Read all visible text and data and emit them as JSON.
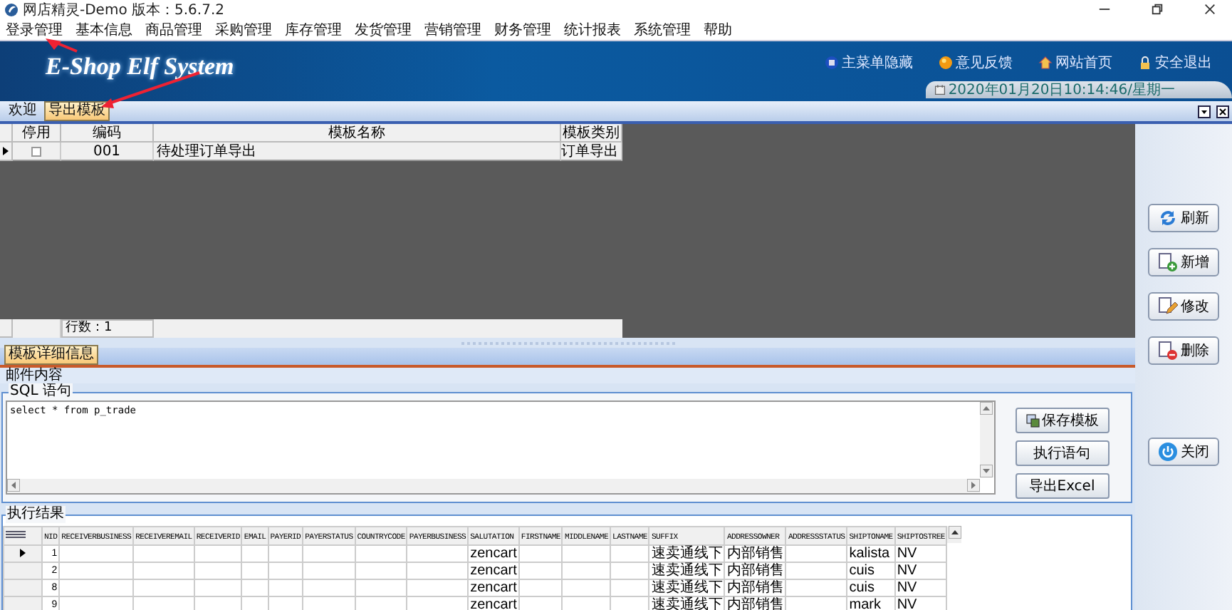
{
  "window": {
    "title": "网店精灵-Demo  版本：5.6.7.2"
  },
  "menu": [
    "登录管理",
    "基本信息",
    "商品管理",
    "采购管理",
    "库存管理",
    "发货管理",
    "营销管理",
    "财务管理",
    "统计报表",
    "系统管理",
    "帮助"
  ],
  "banner": {
    "logo": "E-Shop Elf System",
    "links": [
      {
        "kind": "menu",
        "label": "主菜单隐藏"
      },
      {
        "kind": "feedback",
        "label": "意见反馈"
      },
      {
        "kind": "home",
        "label": "网站首页"
      },
      {
        "kind": "logout",
        "label": "安全退出"
      }
    ],
    "datetime": "2020年01月20日10:14:46/星期一"
  },
  "tabs": [
    {
      "label": "欢迎",
      "selected": false
    },
    {
      "label": "导出模板",
      "selected": true
    }
  ],
  "template_grid": {
    "columns": [
      "停用",
      "编码",
      "模板名称",
      "模板类别"
    ],
    "rows": [
      {
        "selected": true,
        "disabled": false,
        "code": "001",
        "name": "待处理订单导出",
        "category": "订单导出"
      }
    ],
    "row_count": "行数：1"
  },
  "side_buttons": [
    {
      "kind": "refresh",
      "label": "刷新"
    },
    {
      "kind": "add",
      "label": "新增"
    },
    {
      "kind": "edit",
      "label": "修改"
    },
    {
      "kind": "delete",
      "label": "删除"
    },
    {
      "kind": "close",
      "label": "关闭"
    }
  ],
  "detail": {
    "tab": "模板详细信息",
    "mail_label": "邮件内容",
    "sql_legend": "SQL 语句",
    "sql": "select * from p_trade",
    "buttons": [
      {
        "kind": "save",
        "label": "保存模板"
      },
      {
        "kind": "run",
        "label": "执行语句"
      },
      {
        "kind": "export",
        "label": "导出Excel"
      }
    ]
  },
  "results": {
    "legend": "执行结果",
    "columns": [
      "NID",
      "RECEIVERBUSINESS",
      "RECEIVEREMAIL",
      "RECEIVERID",
      "EMAIL",
      "PAYERID",
      "PAYERSTATUS",
      "COUNTRYCODE",
      "PAYERBUSINESS",
      "SALUTATION",
      "FIRSTNAME",
      "MIDDLENAME",
      "LASTNAME",
      "SUFFIX",
      "ADDRESSOWNER",
      "ADDRESSSTATUS",
      "SHIPTONAME",
      "SHIPTOSTREE"
    ],
    "rows": [
      {
        "selected": true,
        "cells": [
          "1",
          "",
          "",
          "",
          "",
          "",
          "",
          "",
          "",
          "zencart",
          "",
          "",
          "",
          "速卖通线下",
          "内部销售",
          "",
          "kalista",
          "NV"
        ]
      },
      {
        "selected": false,
        "cells": [
          "2",
          "",
          "",
          "",
          "",
          "",
          "",
          "",
          "",
          "zencart",
          "",
          "",
          "",
          "速卖通线下",
          "内部销售",
          "",
          "cuis",
          "NV"
        ]
      },
      {
        "selected": false,
        "cells": [
          "8",
          "",
          "",
          "",
          "",
          "",
          "",
          "",
          "",
          "zencart",
          "",
          "",
          "",
          "速卖通线下",
          "内部销售",
          "",
          "cuis",
          "NV"
        ]
      },
      {
        "selected": false,
        "cells": [
          "9",
          "",
          "",
          "",
          "",
          "",
          "",
          "",
          "",
          "zencart",
          "",
          "",
          "",
          "速卖通线下",
          "内部销售",
          "",
          "mark",
          "NV"
        ]
      }
    ]
  }
}
